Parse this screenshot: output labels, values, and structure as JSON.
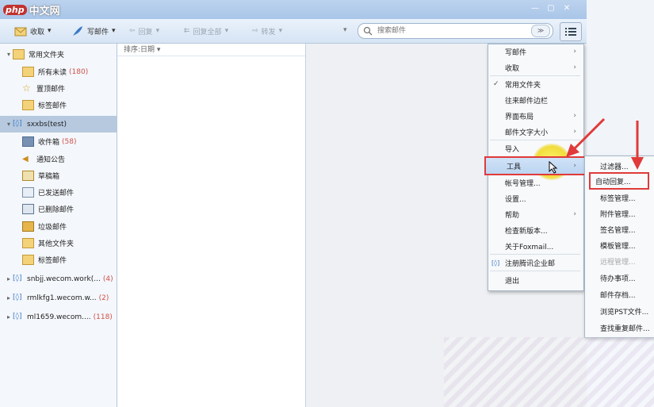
{
  "logo": {
    "brand": "php",
    "suffix": "中文网"
  },
  "window_controls": [
    "—",
    "▢",
    "✕"
  ],
  "toolbar": {
    "receive": "收取",
    "compose": "写邮件",
    "reply": "回复",
    "reply_all": "回复全部",
    "forward": "转发",
    "search_placeholder": "搜索邮件",
    "search_go": "≫"
  },
  "sidebar": {
    "common": "常用文件夹",
    "common_items": [
      {
        "label": "所有未读",
        "count": "(180)"
      },
      {
        "label": "置顶邮件",
        "count": ""
      },
      {
        "label": "标签邮件",
        "count": ""
      }
    ],
    "account": "sxxbs(test)",
    "account_items": [
      {
        "label": "收件箱",
        "count": "(58)"
      },
      {
        "label": "通知公告",
        "count": ""
      },
      {
        "label": "草稿箱",
        "count": ""
      },
      {
        "label": "已发送邮件",
        "count": ""
      },
      {
        "label": "已删除邮件",
        "count": ""
      },
      {
        "label": "垃圾邮件",
        "count": ""
      },
      {
        "label": "其他文件夹",
        "count": ""
      },
      {
        "label": "标签邮件",
        "count": ""
      }
    ],
    "other_accounts": [
      {
        "label": "snbjj.wecom.work(...",
        "count": "(4)"
      },
      {
        "label": "rmlkfg1.wecom.w...",
        "count": "(2)"
      },
      {
        "label": "ml1659.wecom....",
        "count": "(118)"
      }
    ]
  },
  "list": {
    "sort_label": "排序:日期"
  },
  "main_menu": [
    {
      "label": "写邮件",
      "arrow": true
    },
    {
      "label": "收取",
      "arrow": true
    },
    {
      "label": "常用文件夹",
      "check": true
    },
    {
      "label": "往来邮件边栏"
    },
    {
      "label": "界面布局",
      "arrow": true
    },
    {
      "label": "邮件文字大小",
      "arrow": true
    },
    {
      "label": "导入"
    },
    {
      "label": "工具",
      "arrow": true
    },
    {
      "label": "帐号管理..."
    },
    {
      "label": "设置..."
    },
    {
      "label": "帮助",
      "arrow": true
    },
    {
      "label": "检查新版本..."
    },
    {
      "label": "关于Foxmail..."
    },
    {
      "label": "注册腾讯企业邮"
    },
    {
      "label": "退出"
    }
  ],
  "sub_menu": [
    {
      "label": "过滤器..."
    },
    {
      "label": "自动回复..."
    },
    {
      "label": "标签管理..."
    },
    {
      "label": "附件管理..."
    },
    {
      "label": "签名管理..."
    },
    {
      "label": "模板管理..."
    },
    {
      "label": "远程管理...",
      "disabled": true
    },
    {
      "label": "待办事项..."
    },
    {
      "label": "邮件存档..."
    },
    {
      "label": "浏览PST文件..."
    },
    {
      "label": "查找重复邮件..."
    }
  ],
  "colors": {
    "accent_red": "#e03a3a",
    "count_red": "#d0504a",
    "highlight": "#f1dc3d"
  }
}
